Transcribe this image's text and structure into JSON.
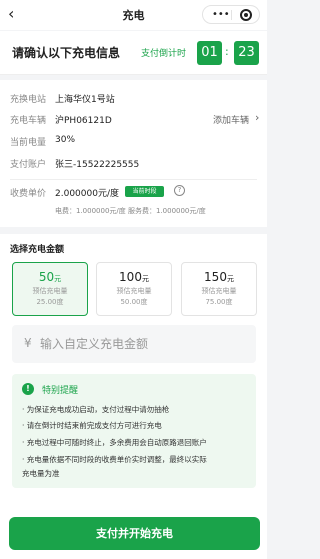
{
  "nav": {
    "back_icon": "‹",
    "title": "充电"
  },
  "confirm": {
    "title": "请确认以下充电信息",
    "countdown_label": "支付倒计时",
    "minutes": "01",
    "colon": ":",
    "seconds": "23"
  },
  "info": {
    "station_label": "充换电站",
    "station_value": "上海华仪1号站",
    "vehicle_label": "充电车辆",
    "vehicle_value": "沪PH06121D",
    "add_vehicle": "添加车辆",
    "soc_label": "当前电量",
    "soc_value": "30%",
    "account_label": "支付账户",
    "account_value": "张三-15522225555",
    "price_label": "收费单价",
    "price_value": "2.000000元/度",
    "time_tag": "当前时段",
    "fees": "电费：1.000000元/度  服务费：1.000000元/度"
  },
  "amount": {
    "section_title": "选择充电金额",
    "options": [
      {
        "amount": "50",
        "unit": "元",
        "est": "预估充电量",
        "deg": "25.00度"
      },
      {
        "amount": "100",
        "unit": "元",
        "est": "预估充电量",
        "deg": "50.00度"
      },
      {
        "amount": "150",
        "unit": "元",
        "est": "预估充电量",
        "deg": "75.00度"
      }
    ],
    "custom_prefix": "¥",
    "custom_placeholder": "输入自定义充电金额"
  },
  "notice": {
    "title": "特别提醒",
    "lines": [
      "· 为保证充电成功启动，支付过程中请勿抽枪",
      "· 请在倒计时结束前完成支付方可进行充电",
      "· 充电过程中可随时终止，多余费用会自动原路退回账户",
      "· 充电量依据不同时段的收费单价实时调整，最终以实际",
      "  充电量为准"
    ]
  },
  "footer": {
    "pay_button": "支付并开始充电"
  },
  "colors": {
    "accent": "#1aa34a"
  }
}
